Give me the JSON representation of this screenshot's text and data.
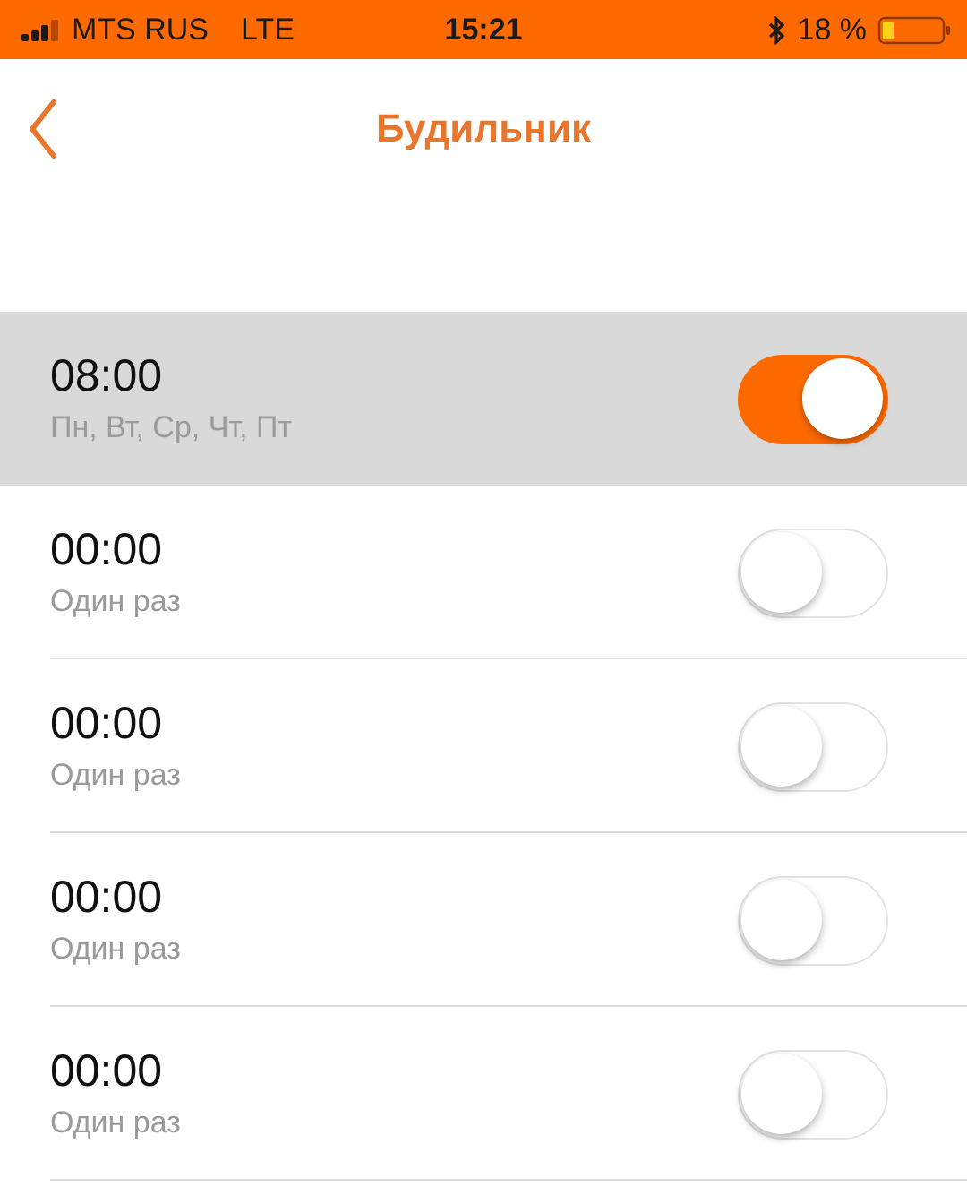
{
  "status_bar": {
    "carrier": "MTS RUS",
    "network": "LTE",
    "time": "15:21",
    "battery": "18 %"
  },
  "nav": {
    "title": "Будильник"
  },
  "alarms": [
    {
      "time": "08:00",
      "repeat": "Пн, Вт, Ср, Чт, Пт",
      "on": true,
      "highlighted": true
    },
    {
      "time": "00:00",
      "repeat": "Один раз",
      "on": false,
      "highlighted": false
    },
    {
      "time": "00:00",
      "repeat": "Один раз",
      "on": false,
      "highlighted": false
    },
    {
      "time": "00:00",
      "repeat": "Один раз",
      "on": false,
      "highlighted": false
    },
    {
      "time": "00:00",
      "repeat": "Один раз",
      "on": false,
      "highlighted": false
    }
  ]
}
